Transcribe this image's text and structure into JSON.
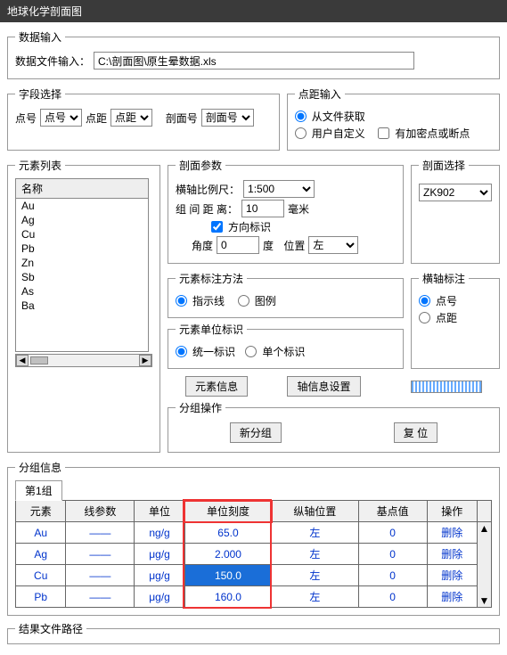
{
  "titlebar": "地球化学剖面图",
  "dataInput": {
    "legend": "数据输入",
    "fileLabel": "数据文件输入：",
    "filePath": "C:\\剖面图\\原生晕数据.xls"
  },
  "fieldSelect": {
    "legend": "字段选择",
    "pointLabel": "点号",
    "pointValue": "点号",
    "distLabel": "点距",
    "distValue": "点距",
    "sectionLabel": "剖面号",
    "sectionValue": "剖面号"
  },
  "distInput": {
    "legend": "点距输入",
    "fromFile": "从文件获取",
    "userDef": "用户自定义",
    "cbLabel": "有加密点或断点"
  },
  "elementList": {
    "legend": "元素列表",
    "header": "名称",
    "items": [
      "Au",
      "Ag",
      "Cu",
      "Pb",
      "Zn",
      "Sb",
      "As",
      "Ba"
    ]
  },
  "sectionParams": {
    "legend": "剖面参数",
    "hscaleLabel": "横轴比例尺：",
    "hscaleValue": "1:500",
    "groupGapLabel": "组 间 距 离：",
    "groupGapValue": "10",
    "gapUnit": "毫米",
    "dirMark": "方向标识",
    "angleLabel": "角度",
    "angleValue": "0",
    "angleUnit": "度",
    "posLabel": "位置",
    "posValue": "左"
  },
  "sectionSelect": {
    "legend": "剖面选择",
    "value": "ZK902"
  },
  "annoMethod": {
    "legend": "元素标注方法",
    "indicator": "指示线",
    "legendOpt": "图例"
  },
  "unitMark": {
    "legend": "元素单位标识",
    "unified": "统一标识",
    "single": "单个标识"
  },
  "haxis": {
    "legend": "横轴标注",
    "byPoint": "点号",
    "byDist": "点距"
  },
  "buttons": {
    "elementInfo": "元素信息",
    "axisInfo": "轴信息设置",
    "newGroup": "新分组",
    "reset": "复    位"
  },
  "groupOps": {
    "legend": "分组操作"
  },
  "groupInfo": {
    "legend": "分组信息",
    "tab1": "第1组",
    "headers": [
      "元素",
      "线参数",
      "单位",
      "单位刻度",
      "纵轴位置",
      "基点值",
      "操作"
    ],
    "rows": [
      {
        "el": "Au",
        "line": "——",
        "unit": "ng/g",
        "scale": "65.0",
        "axis": "左",
        "base": "0",
        "op": "删除"
      },
      {
        "el": "Ag",
        "line": "——",
        "unit": "μg/g",
        "scale": "2.000",
        "axis": "左",
        "base": "0",
        "op": "删除"
      },
      {
        "el": "Cu",
        "line": "——",
        "unit": "μg/g",
        "scale": "150.0",
        "axis": "左",
        "base": "0",
        "op": "删除",
        "sel": true
      },
      {
        "el": "Pb",
        "line": "——",
        "unit": "μg/g",
        "scale": "160.0",
        "axis": "左",
        "base": "0",
        "op": "删除"
      }
    ]
  },
  "resultPath": {
    "legend": "结果文件路径"
  }
}
